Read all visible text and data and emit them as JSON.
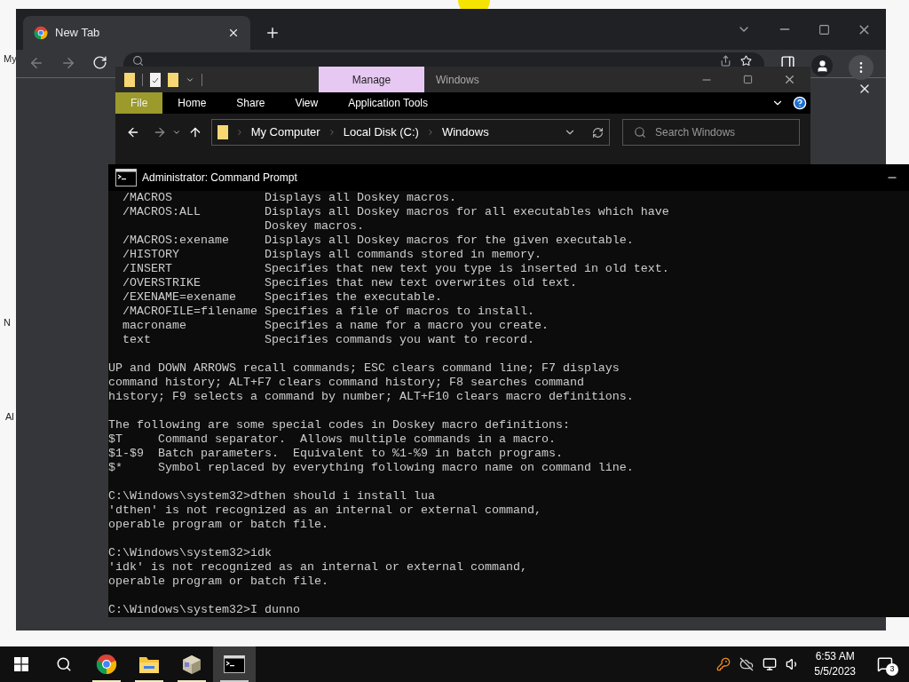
{
  "desktop": {
    "icon_labels": [
      "My",
      "N",
      "Al"
    ]
  },
  "browser": {
    "tabs": [
      {
        "label": "New Tab",
        "selected": true
      }
    ]
  },
  "explorer": {
    "context_tab": "Manage",
    "title": "Windows",
    "ribbon_tabs": [
      {
        "label": "File",
        "selected": true
      },
      {
        "label": "Home",
        "selected": false
      },
      {
        "label": "Share",
        "selected": false
      },
      {
        "label": "View",
        "selected": false
      },
      {
        "label": "Application Tools",
        "selected": false
      }
    ],
    "breadcrumbs": [
      "My Computer",
      "Local Disk (C:)",
      "Windows"
    ],
    "search": {
      "placeholder": "Search Windows"
    }
  },
  "console": {
    "title": "Administrator: Command Prompt",
    "output": "  /MACROS             Displays all Doskey macros.\n  /MACROS:ALL         Displays all Doskey macros for all executables which have\n                      Doskey macros.\n  /MACROS:exename     Displays all Doskey macros for the given executable.\n  /HISTORY            Displays all commands stored in memory.\n  /INSERT             Specifies that new text you type is inserted in old text.\n  /OVERSTRIKE         Specifies that new text overwrites old text.\n  /EXENAME=exename    Specifies the executable.\n  /MACROFILE=filename Specifies a file of macros to install.\n  macroname           Specifies a name for a macro you create.\n  text                Specifies commands you want to record.\n\nUP and DOWN ARROWS recall commands; ESC clears command line; F7 displays\ncommand history; ALT+F7 clears command history; F8 searches command\nhistory; F9 selects a command by number; ALT+F10 clears macro definitions.\n\nThe following are some special codes in Doskey macro definitions:\n$T     Command separator.  Allows multiple commands in a macro.\n$1-$9  Batch parameters.  Equivalent to %1-%9 in batch programs.\n$*     Symbol replaced by everything following macro name on command line.\n\nC:\\Windows\\system32>dthen should i install lua\n'dthen' is not recognized as an internal or external command,\noperable program or batch file.\n\nC:\\Windows\\system32>idk\n'idk' is not recognized as an internal or external command,\noperable program or batch file.\n\nC:\\Windows\\system32>I dunno"
  },
  "taskbar": {
    "apps": [
      {
        "kind": "browser",
        "selected": false
      },
      {
        "kind": "folder",
        "selected": false
      },
      {
        "kind": "package",
        "selected": false
      },
      {
        "kind": "console",
        "selected": true
      }
    ],
    "clock": {
      "time": "6:53 AM",
      "date": "5/5/2023"
    },
    "notifications": {
      "count": "3"
    }
  }
}
